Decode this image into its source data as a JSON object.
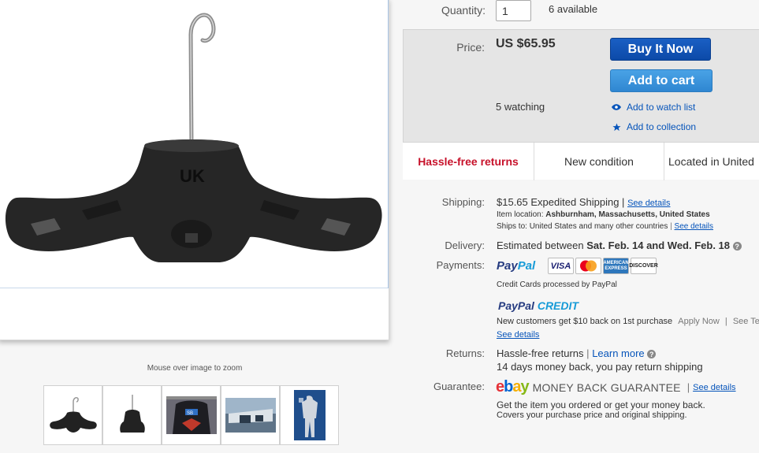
{
  "gallery": {
    "zoom_hint": "Mouse over image to zoom",
    "main_image_icon": "wetsuit-hanger-image",
    "logo_text": "UK",
    "thumbnails": [
      {
        "icon": "hanger-side-thumbnail"
      },
      {
        "icon": "hanger-front-thumbnail"
      },
      {
        "icon": "jacket-photo-thumbnail"
      },
      {
        "icon": "boat-photo-thumbnail"
      },
      {
        "icon": "wetsuit-photo-thumbnail"
      }
    ]
  },
  "quantity": {
    "label": "Quantity:",
    "value": "1",
    "available": "6 available"
  },
  "price": {
    "label": "Price:",
    "value": "US $65.95"
  },
  "actions": {
    "buy_now": "Buy It Now",
    "add_to_cart": "Add to cart",
    "watching": "5 watching",
    "add_to_watch_list": "Add to watch list",
    "add_to_collection": "Add to collection"
  },
  "features": [
    {
      "label": "Hassle-free returns"
    },
    {
      "label": "New condition"
    },
    {
      "label": "Located in United"
    }
  ],
  "shipping": {
    "label": "Shipping:",
    "cost": "$15.65",
    "method": "Expedited Shipping",
    "separator": "|",
    "see_details": "See details",
    "item_location_label": "Item location:",
    "item_location": "Ashburnham, Massachusetts, United States",
    "ships_to_label": "Ships to:",
    "ships_to": "United States and many other countries",
    "ships_see_details": "See details"
  },
  "delivery": {
    "label": "Delivery:",
    "prefix": "Estimated between",
    "range": "Sat. Feb. 14 and Wed. Feb. 18"
  },
  "payments": {
    "label": "Payments:",
    "paypal_a": "Pay",
    "paypal_b": "Pal",
    "cards": {
      "visa": "VISA",
      "mastercard": "MasterCard",
      "amex": "AMERICAN EXPRESS",
      "discover": "DISCOVER"
    },
    "credit_note": "Credit Cards processed by PayPal",
    "credit_a": "PayPal",
    "credit_b": "CREDIT",
    "credit_offer": "New customers get $10 back on 1st purchase",
    "apply_now": "Apply Now",
    "see_terms": "See Te",
    "see_details": "See details"
  },
  "returns": {
    "label": "Returns:",
    "policy": "Hassle-free returns",
    "learn_more": "Learn more",
    "detail": "14 days money back, you pay return shipping"
  },
  "guarantee": {
    "label": "Guarantee:",
    "ebay": [
      "e",
      "b",
      "a",
      "y"
    ],
    "title": "MONEY BACK GUARANTEE",
    "see_details": "See details",
    "line1": "Get the item you ordered or get your money back.",
    "line2": "Covers your purchase price and original shipping."
  },
  "colors": {
    "link": "#0654ba",
    "buy_now": "#0c4aa8",
    "add_to_cart": "#2f86d1",
    "returns_red": "#c7112a"
  }
}
